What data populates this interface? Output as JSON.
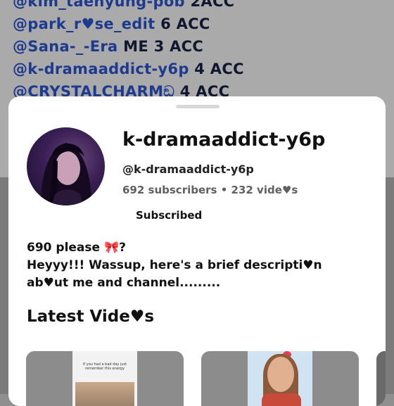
{
  "background_list": [
    {
      "handle": "@kim_taehyung-pob",
      "suffix": " 2ACC"
    },
    {
      "handle": " @park_r♥se_edit",
      "suffix": " 6 ACC"
    },
    {
      "handle": "@Sana-_-Era",
      "suffix": " ME 3 ACC"
    },
    {
      "handle": "@k-dramaaddict-y6p",
      "suffix": " 4 ACC"
    },
    {
      "handle": "@CRYSTALCHARMඞ",
      "suffix": " 4 ACC"
    }
  ],
  "channel": {
    "name": "k-dramaaddict-y6p",
    "handle": "@k-dramaaddict-y6p",
    "stats": "692 subscribers • 232 vide♥s",
    "subscribe_label": "Subscribed"
  },
  "description": {
    "line1": "690 please 🎀?",
    "line2": "Heyyy!!! Wassup, here's a brief descripti♥n",
    "line3": "ab♥ut me and channel........."
  },
  "latest_videos": {
    "heading": "Latest Vide♥s",
    "video1_caption": "If you had a bad day just remember this energy"
  },
  "colors": {
    "handle_blue": "#1e3a8f",
    "sheet_bg": "#ffffff",
    "stats_gray": "#606060"
  }
}
